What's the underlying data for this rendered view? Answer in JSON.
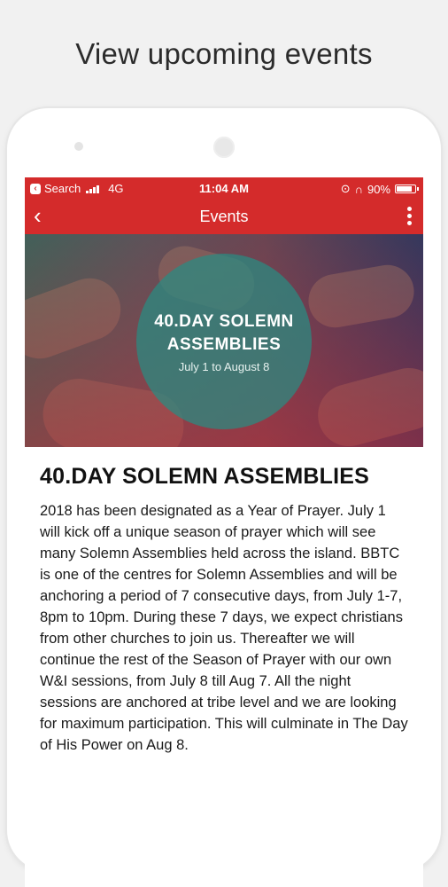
{
  "headline": "View upcoming events",
  "status_bar": {
    "carrier": "Search",
    "network": "4G",
    "time": "11:04 AM",
    "battery": "90%",
    "battery_level": 0.9
  },
  "app_bar": {
    "back_icon": "chevron-left-icon",
    "title": "Events",
    "more_icon": "more-vertical-icon"
  },
  "banner": {
    "title_line1": "40.DAY SOLEMN",
    "title_line2": "ASSEMBLIES",
    "date": "July 1 to August 8"
  },
  "event": {
    "title": "40.DAY SOLEMN ASSEMBLIES",
    "description": "2018 has been designated as a Year of Prayer. July 1 will kick off a unique season of prayer which will see many Solemn Assemblies held across the island. BBTC is one of the centres for Solemn Assemblies and will be anchoring a period of 7 consecutive days, from July 1-7, 8pm to 10pm. During these 7 days, we expect christians from other churches to join us. Thereafter we will continue the rest of the Season of Prayer with our own W&I sessions, from July 8 till Aug 7. All the night sessions are anchored at tribe level and we are looking for maximum participation. This will culminate in The Day of His Power on Aug 8."
  },
  "colors": {
    "accent": "#d42b2b",
    "background": "#f1f1f1"
  }
}
